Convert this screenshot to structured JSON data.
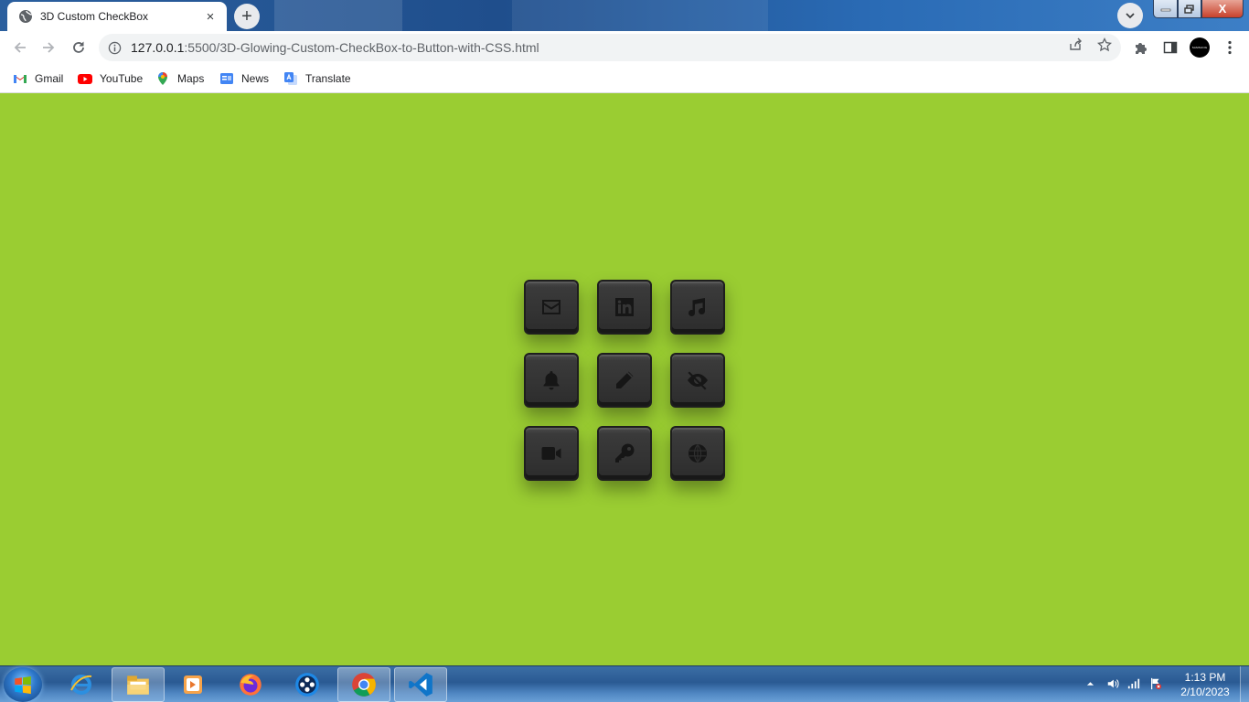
{
  "browser": {
    "tab_title": "3D Custom CheckBox",
    "tab_close": "×",
    "new_tab": "+",
    "url_host": "127.0.0.1",
    "url_rest": ":5500/3D-Glowing-Custom-CheckBox-to-Button-with-CSS.html",
    "window_close": "X",
    "profile_label": "SAMSUNG"
  },
  "bookmarks": [
    {
      "label": "Gmail",
      "icon": "gmail-icon"
    },
    {
      "label": "YouTube",
      "icon": "youtube-icon"
    },
    {
      "label": "Maps",
      "icon": "maps-icon"
    },
    {
      "label": "News",
      "icon": "news-icon"
    },
    {
      "label": "Translate",
      "icon": "translate-icon"
    }
  ],
  "page": {
    "background": "#9acd32",
    "checkboxes": [
      {
        "icon": "envelope-icon"
      },
      {
        "icon": "linkedin-icon"
      },
      {
        "icon": "music-icon"
      },
      {
        "icon": "bell-icon"
      },
      {
        "icon": "pencil-icon"
      },
      {
        "icon": "eye-slash-icon"
      },
      {
        "icon": "video-icon"
      },
      {
        "icon": "key-icon"
      },
      {
        "icon": "globe-icon"
      }
    ]
  },
  "taskbar": {
    "apps": [
      "internet-explorer-icon",
      "file-explorer-icon",
      "media-player-icon",
      "firefox-icon",
      "video-editor-icon",
      "chrome-icon",
      "vscode-icon"
    ],
    "time": "1:13 PM",
    "date": "2/10/2023"
  }
}
